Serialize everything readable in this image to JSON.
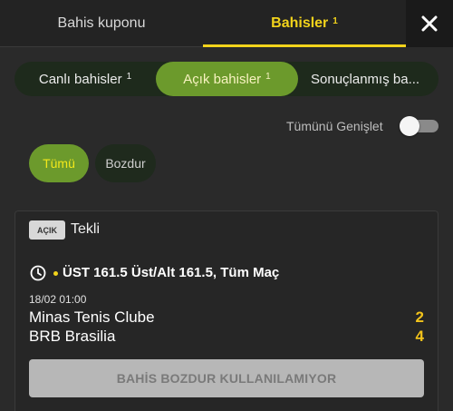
{
  "top_tabs": {
    "coupon": "Bahis kuponu",
    "bets": "Bahisler",
    "bets_count": "1"
  },
  "segments": {
    "live": "Canlı bahisler",
    "live_count": "1",
    "open": "Açık bahisler",
    "open_count": "1",
    "settled": "Sonuçlanmış ba..."
  },
  "expand_all": {
    "label": "Tümünü Genişlet",
    "on": false
  },
  "filters": {
    "all": "Tümü",
    "cashout": "Bozdur"
  },
  "bet": {
    "status_badge": "AÇIK",
    "type": "Tekli",
    "market": "ÜST 161.5 Üst/Alt 161.5, Tüm Maç",
    "datetime": "18/02 01:00",
    "team1": "Minas Tenis Clube",
    "score1": "2",
    "team2": "BRB Brasilia",
    "score2": "4",
    "cashout_button": "BAHİS BOZDUR KULLANILAMIYOR"
  },
  "colors": {
    "accent_yellow": "#f2d31b",
    "active_green": "#6c9a2c",
    "background": "#2a2a2a"
  },
  "icons": {
    "close": "close-icon",
    "clock": "clock-icon"
  }
}
